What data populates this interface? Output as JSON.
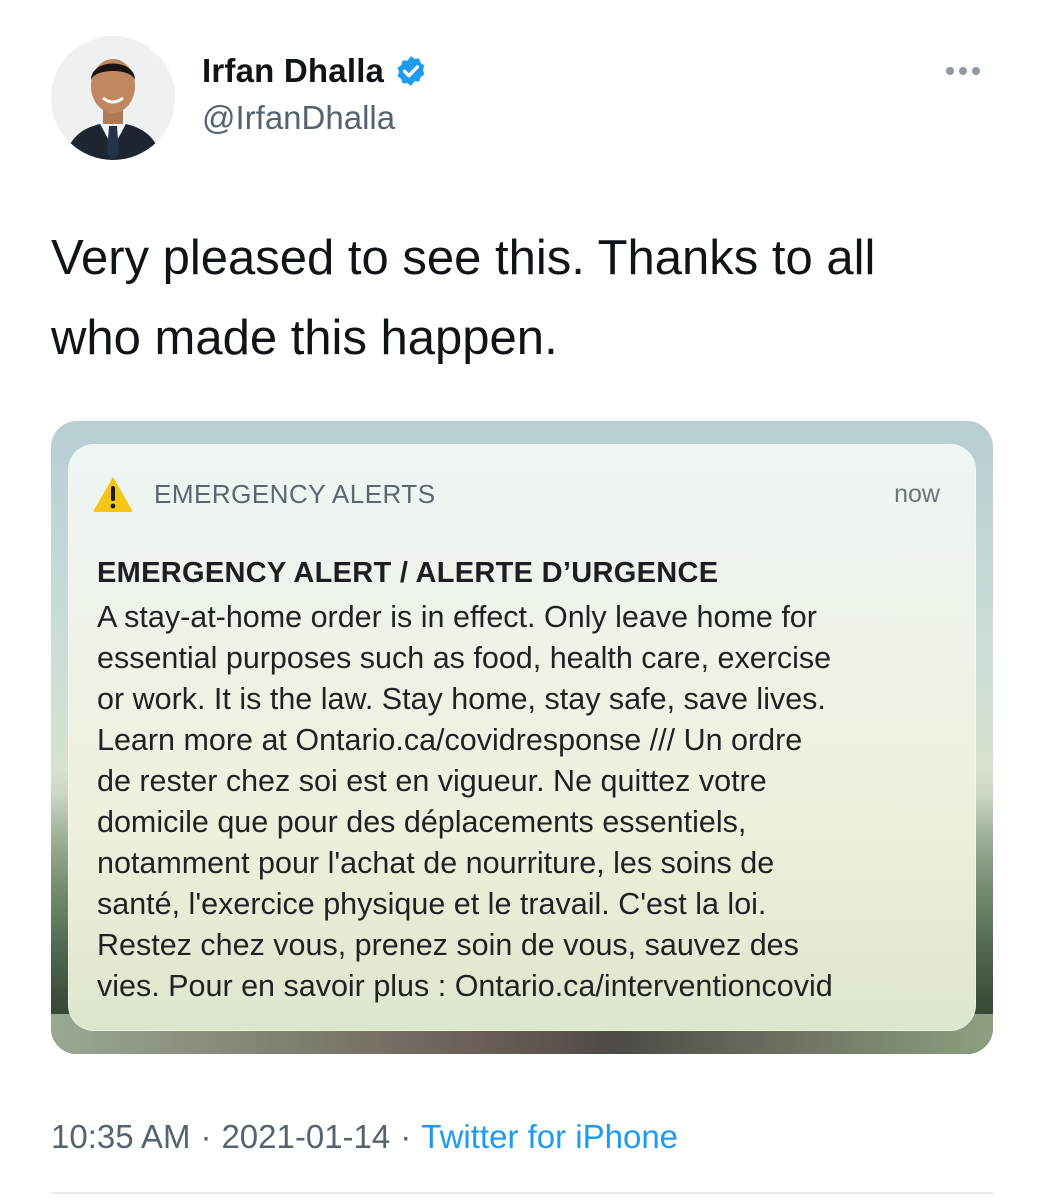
{
  "tweet": {
    "author_name": "Irfan Dhalla",
    "author_handle": "@IrfanDhalla",
    "text_lines": [
      "Very pleased to see this. Thanks to all",
      "who made this happen."
    ],
    "time": "10:35 AM",
    "date": "2021-01-14",
    "separator": "·",
    "source": "Twitter for iPhone",
    "icons": {
      "verified": "verified-badge-icon",
      "more": "more-options-icon",
      "warning": "warning-triangle-icon"
    },
    "colors": {
      "verified": "#1d9bf0",
      "link": "#1d9bf0",
      "secondary_text": "#536471",
      "warning": "#f5c518"
    }
  },
  "alert": {
    "app_name": "EMERGENCY ALERTS",
    "time": "now",
    "title": "EMERGENCY ALERT / ALERTE D’URGENCE",
    "body_lines": [
      "A stay-at-home order is in effect. Only leave home for",
      "essential purposes such as food, health care, exercise",
      "or work. It is the law. Stay home, stay safe, save lives.",
      "Learn more at Ontario.ca/covidresponse /// Un ordre",
      "de rester chez soi est en vigueur. Ne quittez votre",
      "domicile que pour des déplacements essentiels,",
      "notamment pour l'achat de nourriture, les soins de",
      "santé, l'exercice physique et le travail. C'est la loi.",
      "Restez chez vous, prenez soin de vous, sauvez des",
      "vies. Pour en savoir plus : Ontario.ca/interventioncovid"
    ]
  }
}
